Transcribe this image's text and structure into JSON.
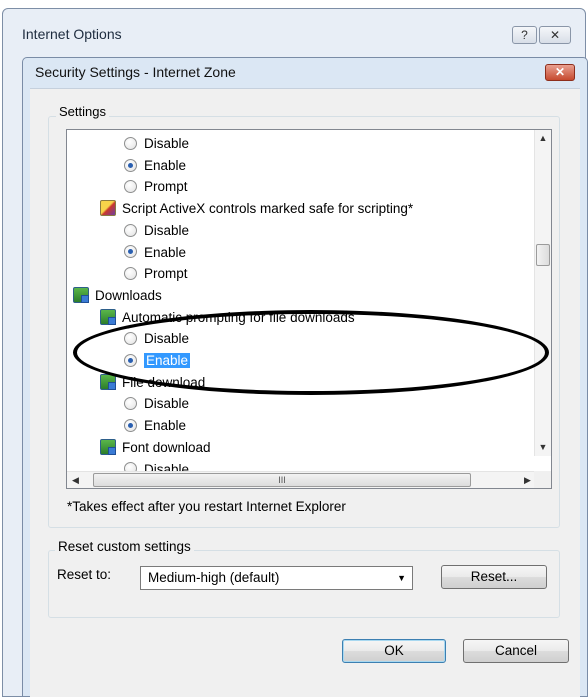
{
  "outer_window": {
    "title": "Internet Options",
    "help_label": "?",
    "close_label": "✕"
  },
  "dialog": {
    "title": "Security Settings - Internet Zone",
    "close_label": "✕"
  },
  "settings": {
    "legend": "Settings",
    "rows": [
      {
        "text": "Disable",
        "kind": "radio",
        "checked": false
      },
      {
        "text": "Enable",
        "kind": "radio",
        "checked": true
      },
      {
        "text": "Prompt",
        "kind": "radio",
        "checked": false
      },
      {
        "text": "Script ActiveX controls marked safe for scripting*",
        "kind": "item",
        "icon": "script-icon"
      },
      {
        "text": "Disable",
        "kind": "radio",
        "checked": false
      },
      {
        "text": "Enable",
        "kind": "radio",
        "checked": true
      },
      {
        "text": "Prompt",
        "kind": "radio",
        "checked": false
      },
      {
        "text": "Downloads",
        "kind": "category",
        "icon": "downloads-icon"
      },
      {
        "text": "Automatic prompting for file downloads",
        "kind": "item",
        "icon": "download-setting-icon"
      },
      {
        "text": "Disable",
        "kind": "radio",
        "checked": false
      },
      {
        "text": "Enable",
        "kind": "radio",
        "checked": true,
        "selected": true
      },
      {
        "text": "File download",
        "kind": "item",
        "icon": "download-setting-icon"
      },
      {
        "text": "Disable",
        "kind": "radio",
        "checked": false
      },
      {
        "text": "Enable",
        "kind": "radio",
        "checked": true
      },
      {
        "text": "Font download",
        "kind": "item",
        "icon": "download-setting-icon"
      },
      {
        "text": "Disable",
        "kind": "radio",
        "checked": false
      }
    ],
    "hscroll_grip": "III",
    "note": "*Takes effect after you restart Internet Explorer"
  },
  "reset": {
    "legend": "Reset custom settings",
    "label": "Reset to:",
    "selected": "Medium-high (default)",
    "button": "Reset..."
  },
  "footer": {
    "ok": "OK",
    "cancel": "Cancel"
  }
}
